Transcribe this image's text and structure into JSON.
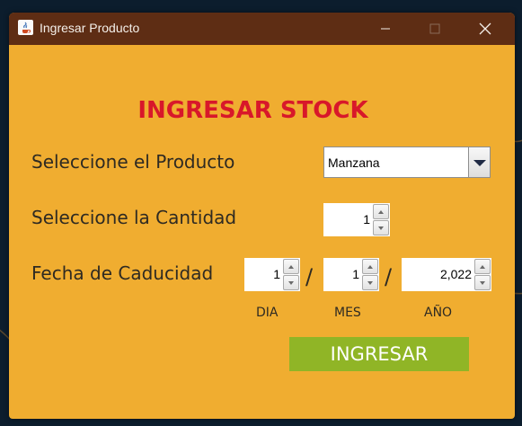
{
  "window": {
    "title": "Ingresar Producto"
  },
  "form": {
    "heading": "INGRESAR STOCK",
    "product_label": "Seleccione el Producto",
    "product_value": "Manzana",
    "quantity_label": "Seleccione la Cantidad",
    "quantity_value": "1",
    "expiry_label": "Fecha de Caducidad",
    "day_value": "1",
    "month_value": "1",
    "year_value": "2,022",
    "separator": "/",
    "day_label": "DIA",
    "month_label": "MES",
    "year_label": "AÑO",
    "submit_label": "INGRESAR"
  },
  "colors": {
    "window_bg": "#f0ad30",
    "titlebar_bg": "#5e2d14",
    "heading": "#d8182a",
    "submit_bg": "#90b526",
    "desktop_bg": "#0c1d2d"
  },
  "icons": [
    "java-app-icon",
    "minimize-icon",
    "maximize-icon",
    "close-icon",
    "dropdown-arrow-icon",
    "spinner-up-icon",
    "spinner-down-icon"
  ]
}
